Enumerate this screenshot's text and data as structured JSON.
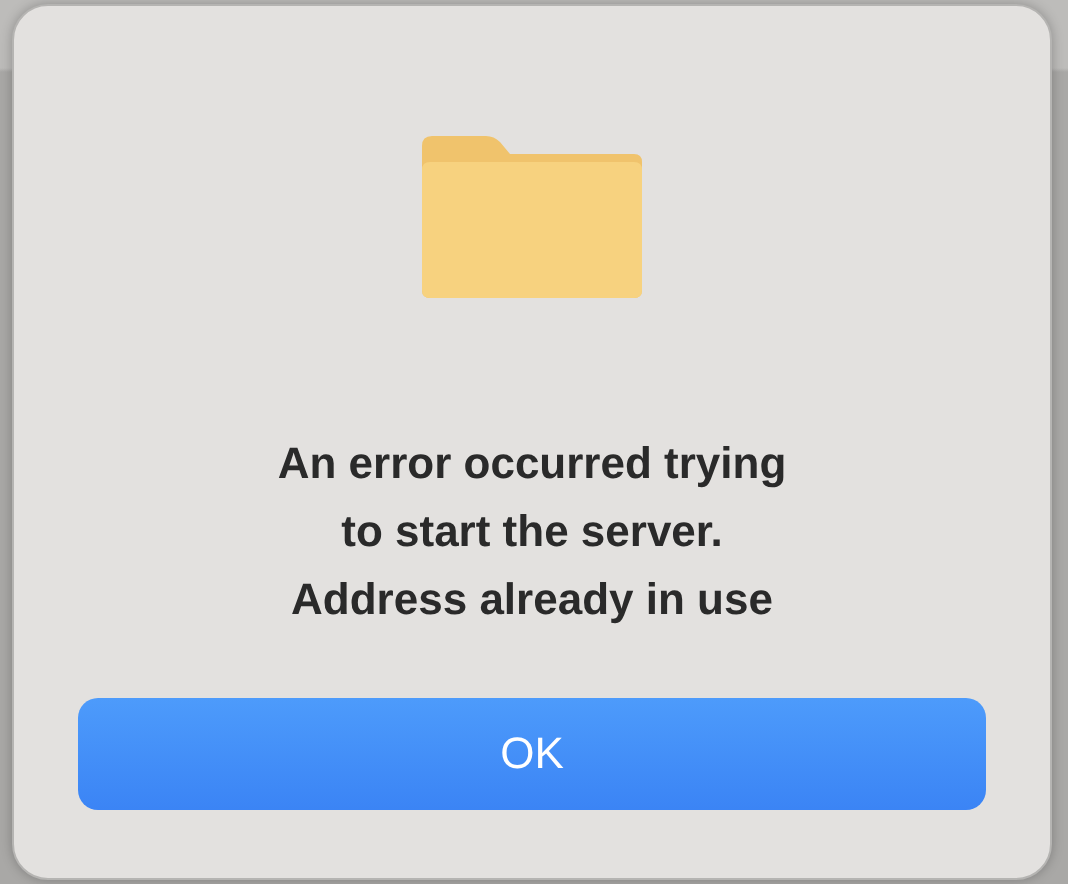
{
  "alert": {
    "message_lines": [
      "An error occurred trying",
      "to start the server.",
      "Address already in use"
    ],
    "buttons": [
      {
        "label": "OK",
        "kind": "default"
      }
    ]
  }
}
